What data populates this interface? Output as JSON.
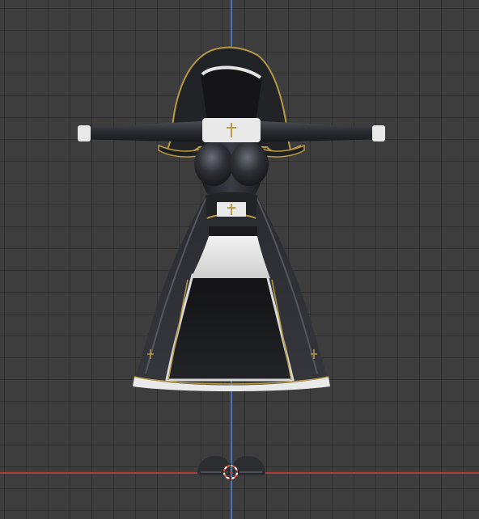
{
  "app": "3D Viewport",
  "view": {
    "grid": true,
    "axes": [
      "x",
      "z"
    ],
    "object": "nun-outfit-model"
  },
  "colors": {
    "background": "#3d3d3d",
    "grid_line": "#333333",
    "x_axis": "#b03a3a",
    "z_axis": "#4a74b8",
    "cloth_dark": "#1c1c1e",
    "cloth_mid": "#2e3036",
    "trim_gold": "#b89a45",
    "cloth_white": "#e9e9e9",
    "cursor_red": "#e05a40"
  }
}
